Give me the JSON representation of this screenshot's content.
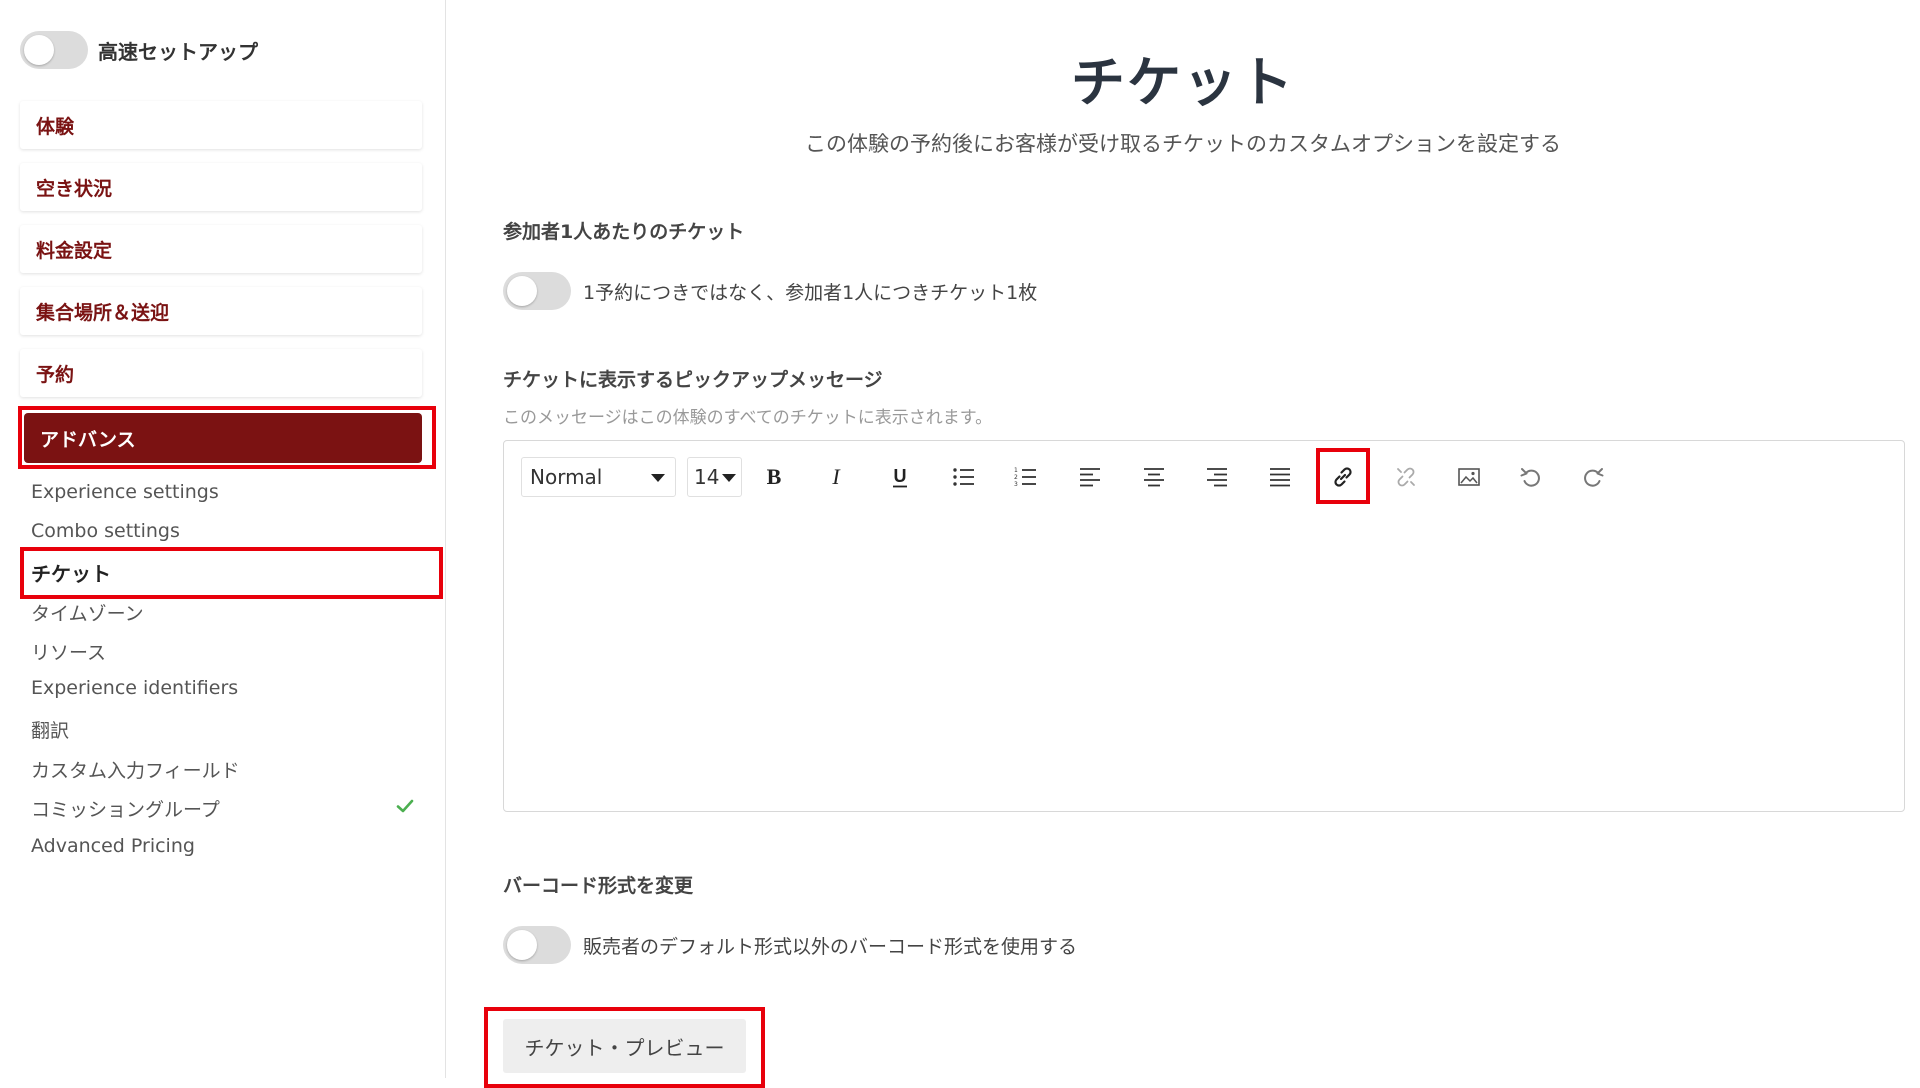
{
  "sidebar": {
    "quick_setup_label": "高速セットアップ",
    "quick_setup_on": false,
    "cards": [
      {
        "label": "体験"
      },
      {
        "label": "空き状況"
      },
      {
        "label": "料金設定"
      },
      {
        "label": "集合場所＆送迎"
      },
      {
        "label": "予約"
      },
      {
        "label": "アドバンス"
      }
    ],
    "sub_items": [
      {
        "label": "Experience settings"
      },
      {
        "label": "Combo settings"
      },
      {
        "label": "チケット"
      },
      {
        "label": "タイムゾーン"
      },
      {
        "label": "リソース"
      },
      {
        "label": "Experience identifiers"
      },
      {
        "label": "翻訳"
      },
      {
        "label": "カスタム入力フィールド"
      },
      {
        "label": "コミッショングループ"
      },
      {
        "label": "Advanced Pricing"
      }
    ]
  },
  "main": {
    "title": "チケット",
    "subtitle": "この体験の予約後にお客様が受け取るチケットのカスタムオプションを設定する",
    "per_participant": {
      "heading": "参加者1人あたりのチケット",
      "toggle_label": "1予約につきではなく、参加者1人につきチケット1枚",
      "on": false
    },
    "pickup_message": {
      "heading": "チケットに表示するピックアップメッセージ",
      "hint": "このメッセージはこの体験のすべてのチケットに表示されます。",
      "toolbar": {
        "style_value": "Normal",
        "size_value": "14"
      }
    },
    "barcode": {
      "heading": "バーコード形式を変更",
      "toggle_label": "販売者のデフォルト形式以外のバーコード形式を使用する",
      "on": false
    },
    "preview_button": "チケット・プレビュー"
  },
  "colors": {
    "brand": "#7b1212",
    "highlight": "#e8000b",
    "check": "#4caf50"
  }
}
